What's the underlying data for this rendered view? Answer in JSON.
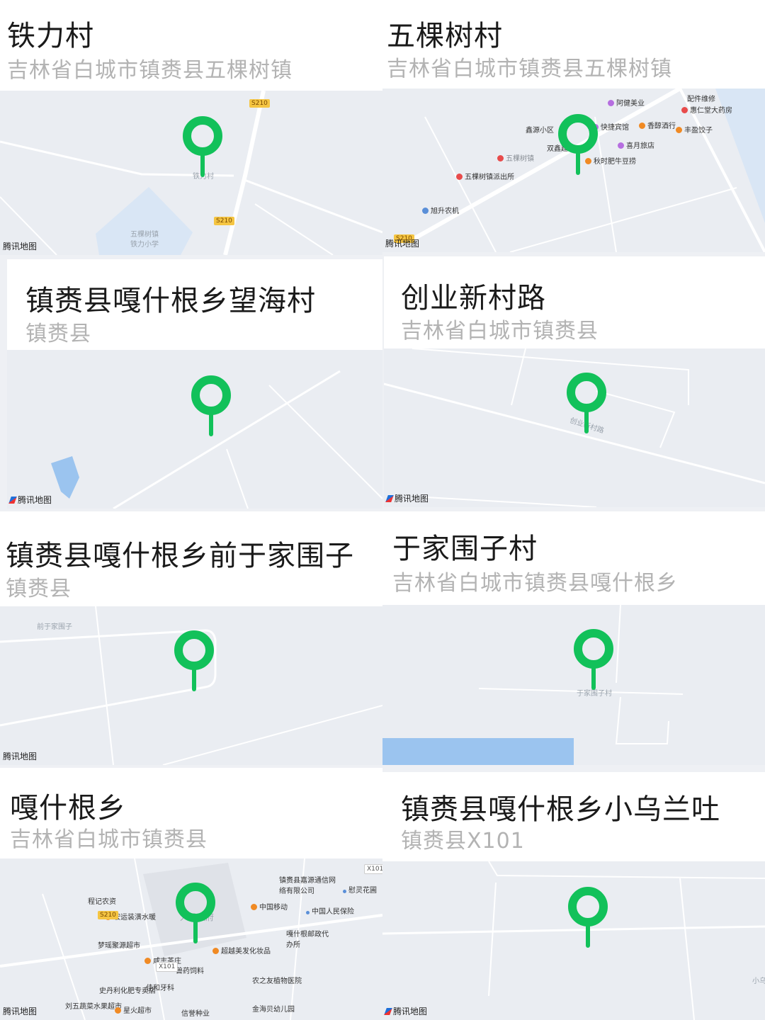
{
  "map_provider": "腾讯地图",
  "accent_color": "#12c15a",
  "cards": [
    {
      "title": "铁力村",
      "subtitle": "吉林省白城市镇赉县五棵树镇",
      "map_labels": [
        "铁力村",
        "五棵树镇",
        "铁力小学"
      ],
      "road_badges": [
        "S210",
        "S210"
      ]
    },
    {
      "title": "五棵树村",
      "subtitle": "吉林省白城市镇赉县五棵树镇",
      "map_labels": [
        "五棵树镇",
        "配件维修",
        "惠仁堂大药房",
        "阿健美业",
        "鑫源小区",
        "快捷宾馆",
        "香醇酒行",
        "丰盈饺子",
        "双鑫超",
        "喜月旅店",
        "秋时肥牛豆捞",
        "五棵树镇派出所",
        "旭升农机"
      ],
      "road_badges": [
        "S210"
      ]
    },
    {
      "title": "镇赉县嘎什根乡望海村",
      "subtitle": "镇赉县",
      "map_labels": [],
      "road_badges": []
    },
    {
      "title": "创业新村路",
      "subtitle": "吉林省白城市镇赉县",
      "map_labels": [
        "创业新村路"
      ],
      "road_badges": []
    },
    {
      "title": "镇赉县嘎什根乡前于家围子",
      "subtitle": "镇赉县",
      "map_labels": [
        "前于家围子"
      ],
      "road_badges": []
    },
    {
      "title": "于家围子村",
      "subtitle": "吉林省白城市镇赉县嘎什根乡",
      "map_labels": [
        "于家围子村"
      ],
      "road_badges": []
    },
    {
      "title": "嘎什根乡",
      "subtitle": "吉林省白城市镇赉县",
      "map_labels": [
        "镇赉县嘉源通信网络有限公司",
        "慰灵花圃",
        "程记农资",
        "宏运装潢水暖",
        "中国移动",
        "中国人民保险",
        "梦瑶聚源超市",
        "嘎什根邮政代办所",
        "超越美发化妆品",
        "咸志茶庄",
        "兽药饲料",
        "农之友植物医院",
        "佳和牙科",
        "史丹利化肥专卖店",
        "刘五蔬菜水果超市",
        "星火超市",
        "信誉种业",
        "金海贝幼儿园",
        "人民政府"
      ],
      "road_badges": [
        "X101",
        "S210",
        "X101"
      ]
    },
    {
      "title": "镇赉县嘎什根乡小乌兰吐",
      "subtitle": "镇赉县X101",
      "map_labels": [
        "小乌"
      ],
      "road_badges": []
    }
  ]
}
